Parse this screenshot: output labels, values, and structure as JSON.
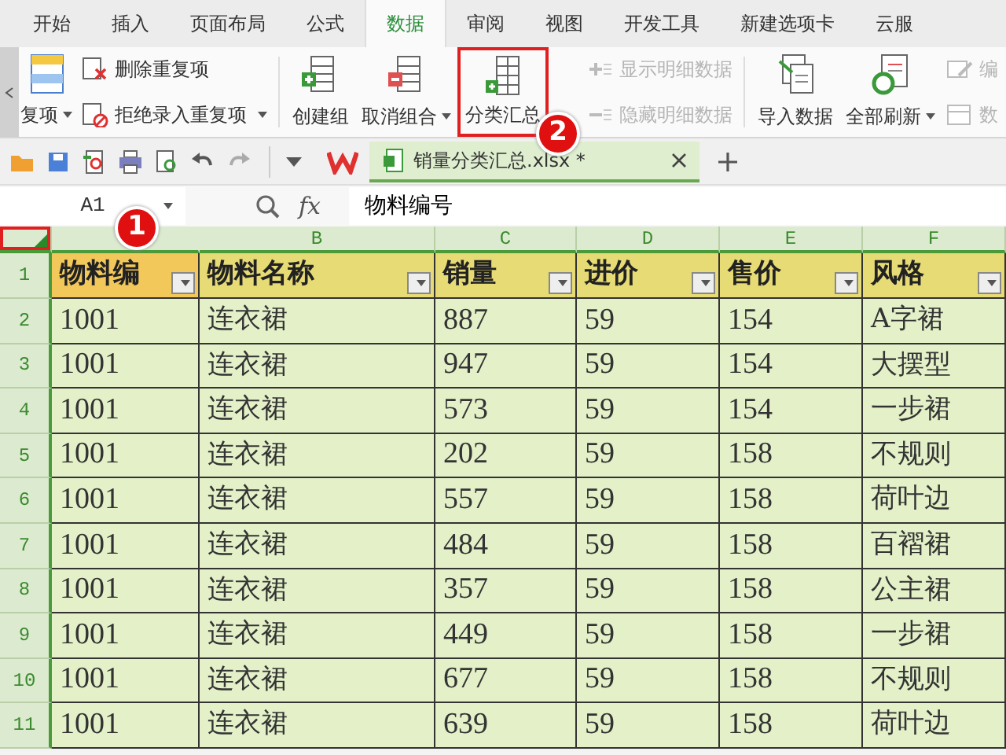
{
  "ribbon_tabs": [
    {
      "label": "开始",
      "selected": false
    },
    {
      "label": "插入",
      "selected": false
    },
    {
      "label": "页面布局",
      "selected": false
    },
    {
      "label": "公式",
      "selected": false
    },
    {
      "label": "数据",
      "selected": true
    },
    {
      "label": "审阅",
      "selected": false
    },
    {
      "label": "视图",
      "selected": false
    },
    {
      "label": "开发工具",
      "selected": false
    },
    {
      "label": "新建选项卡",
      "selected": false
    },
    {
      "label": "云服",
      "selected": false
    }
  ],
  "ribbon": [
    {
      "kind": "large",
      "label": "复项",
      "dropdown": true,
      "disabled": false,
      "highlighted": false
    },
    {
      "kind": "stack",
      "items": [
        {
          "label": "删除重复项",
          "dropdown": false,
          "disabled": false
        },
        {
          "label": "拒绝录入重复项",
          "dropdown": true,
          "disabled": false
        }
      ]
    },
    {
      "kind": "separator"
    },
    {
      "kind": "large",
      "label": "创建组",
      "dropdown": false,
      "disabled": false,
      "highlighted": false
    },
    {
      "kind": "large",
      "label": "取消组合",
      "dropdown": true,
      "disabled": false,
      "highlighted": false
    },
    {
      "kind": "large",
      "label": "分类汇总",
      "dropdown": false,
      "disabled": false,
      "highlighted": true,
      "callout": "2"
    },
    {
      "kind": "stack",
      "items": [
        {
          "label": "显示明细数据",
          "dropdown": false,
          "disabled": true
        },
        {
          "label": "隐藏明细数据",
          "dropdown": false,
          "disabled": true
        }
      ]
    },
    {
      "kind": "separator"
    },
    {
      "kind": "large",
      "label": "导入数据",
      "dropdown": false,
      "disabled": false,
      "highlighted": false
    },
    {
      "kind": "large",
      "label": "全部刷新",
      "dropdown": true,
      "disabled": false,
      "highlighted": false
    },
    {
      "kind": "stack",
      "items": [
        {
          "label": "编",
          "dropdown": false,
          "disabled": true
        },
        {
          "label": "数",
          "dropdown": false,
          "disabled": true
        }
      ]
    }
  ],
  "document_tab": {
    "title": "销量分类汇总.xlsx *",
    "selected": true
  },
  "formula_bar": {
    "cell_ref": "A1",
    "fx_label": "fx",
    "value": "物料编号"
  },
  "sheet": {
    "corner": {
      "highlighted": true,
      "callout": "1"
    },
    "columns": [
      {
        "kind": "blank"
      },
      {
        "kind": "letter",
        "letter": "B"
      },
      {
        "kind": "letter",
        "letter": "C"
      },
      {
        "kind": "letter",
        "letter": "D"
      },
      {
        "kind": "letter",
        "letter": "E"
      },
      {
        "kind": "letter",
        "letter": "F"
      }
    ],
    "header_row": {
      "number": "1",
      "cells": [
        {
          "text": "物料编",
          "selected": true
        },
        {
          "text": "物料名称",
          "selected": false
        },
        {
          "text": "销量",
          "selected": false
        },
        {
          "text": "进价",
          "selected": false
        },
        {
          "text": "售价",
          "selected": false
        },
        {
          "text": "风格",
          "selected": false
        }
      ]
    },
    "rows": [
      {
        "number": "2",
        "cells": [
          "1001",
          "连衣裙",
          "887",
          "59",
          "154",
          "A字裙"
        ]
      },
      {
        "number": "3",
        "cells": [
          "1001",
          "连衣裙",
          "947",
          "59",
          "154",
          "大摆型"
        ]
      },
      {
        "number": "4",
        "cells": [
          "1001",
          "连衣裙",
          "573",
          "59",
          "154",
          "一步裙"
        ]
      },
      {
        "number": "5",
        "cells": [
          "1001",
          "连衣裙",
          "202",
          "59",
          "158",
          "不规则"
        ]
      },
      {
        "number": "6",
        "cells": [
          "1001",
          "连衣裙",
          "557",
          "59",
          "158",
          "荷叶边"
        ]
      },
      {
        "number": "7",
        "cells": [
          "1001",
          "连衣裙",
          "484",
          "59",
          "158",
          "百褶裙"
        ]
      },
      {
        "number": "8",
        "cells": [
          "1001",
          "连衣裙",
          "357",
          "59",
          "158",
          "公主裙"
        ]
      },
      {
        "number": "9",
        "cells": [
          "1001",
          "连衣裙",
          "449",
          "59",
          "158",
          "一步裙"
        ]
      },
      {
        "number": "10",
        "cells": [
          "1001",
          "连衣裙",
          "677",
          "59",
          "158",
          "不规则"
        ]
      },
      {
        "number": "11",
        "cells": [
          "1001",
          "连衣裙",
          "639",
          "59",
          "158",
          "荷叶边"
        ]
      }
    ]
  }
}
